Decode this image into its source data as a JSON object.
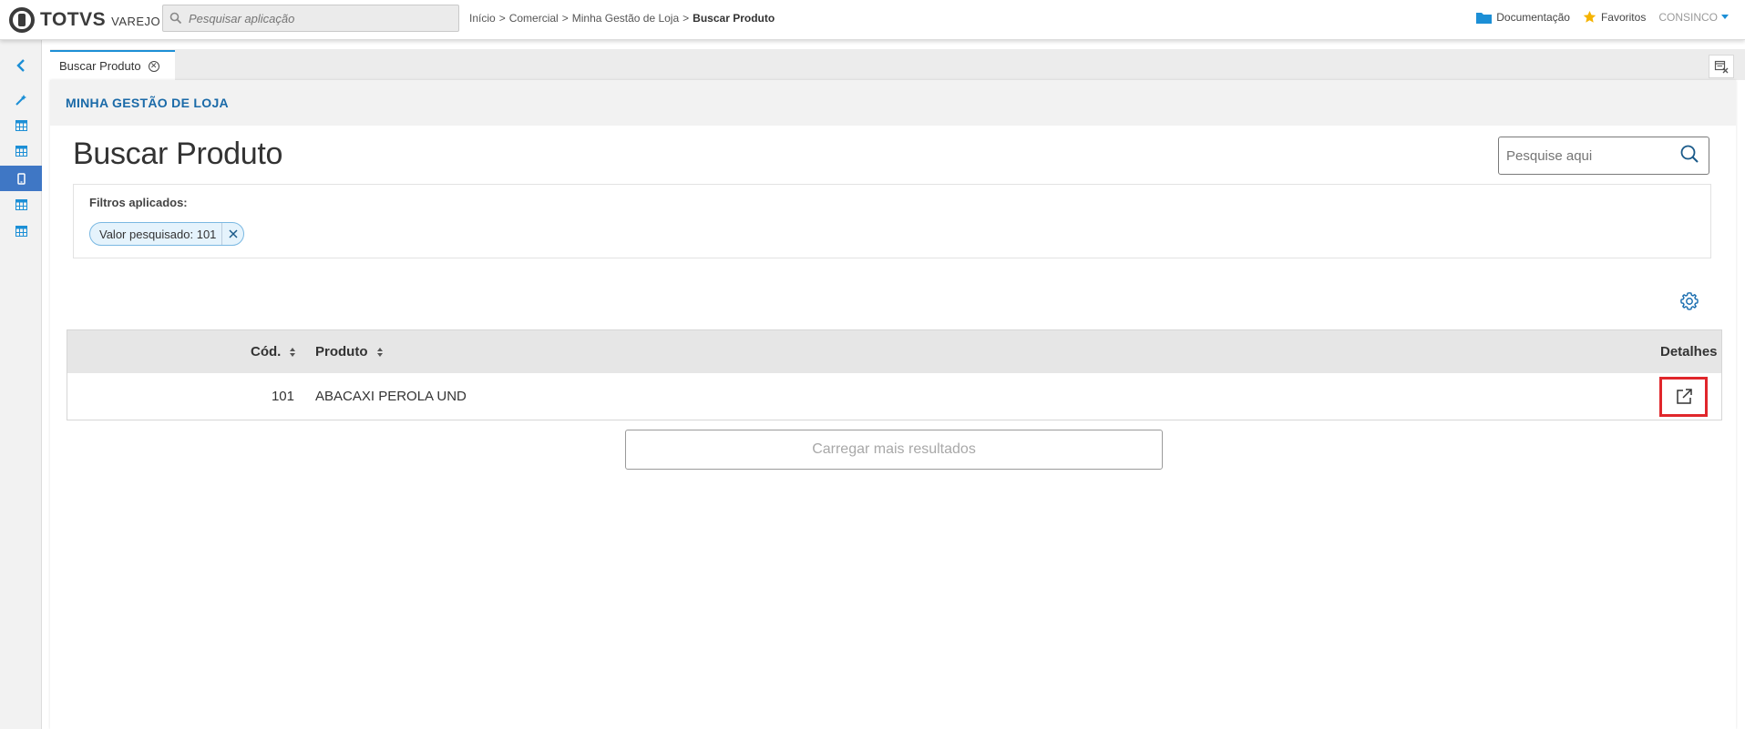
{
  "header": {
    "logo_text": "TOTVS",
    "logo_sub": "VAREJO",
    "app_search_placeholder": "Pesquisar aplicação",
    "breadcrumb": [
      "Início",
      "Comercial",
      "Minha Gestão de Loja",
      "Buscar Produto"
    ],
    "breadcrumb_sep": ">",
    "documentation_label": "Documentação",
    "favorites_label": "Favoritos",
    "user_label": "CONSINCO"
  },
  "tabs": [
    {
      "label": "Buscar Produto",
      "active": true
    }
  ],
  "module": {
    "title": "MINHA GESTÃO DE LOJA"
  },
  "page": {
    "title": "Buscar Produto",
    "search_placeholder": "Pesquise aqui"
  },
  "filters": {
    "label": "Filtros aplicados:",
    "chips": [
      {
        "label": "Valor pesquisado: 101"
      }
    ]
  },
  "table": {
    "columns": [
      {
        "label": "Cód.",
        "sortable": true
      },
      {
        "label": "Produto",
        "sortable": true
      },
      {
        "label": "Detalhes",
        "sortable": false
      }
    ],
    "rows": [
      {
        "codigo": "101",
        "produto": "ABACAXI PEROLA UND"
      }
    ]
  },
  "load_more_label": "Carregar mais resultados",
  "colors": {
    "accent": "#1c8fd6",
    "module_title": "#1a6aa8",
    "sidebar_active": "#3f77c5",
    "highlight_border": "#e0262b",
    "favorite_star": "#f5b301"
  }
}
